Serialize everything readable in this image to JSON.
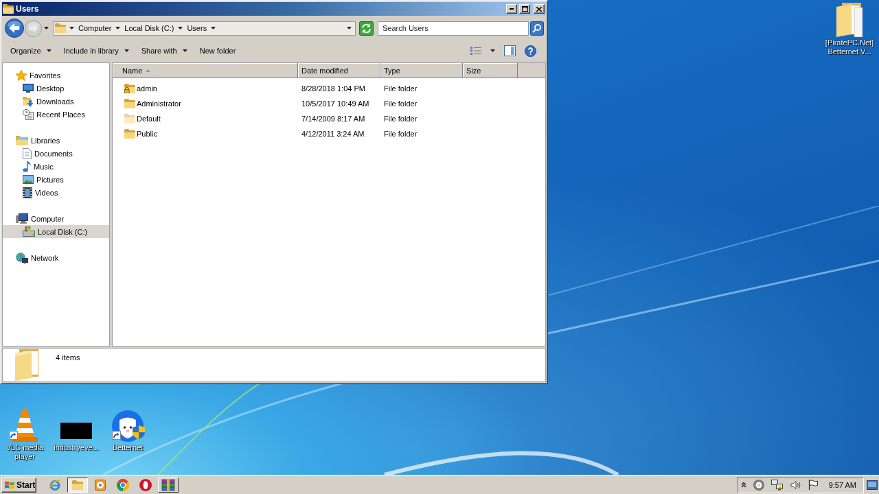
{
  "window": {
    "title": "Users"
  },
  "nav_buttons": [
    {
      "kind": "back",
      "disabled": false
    },
    {
      "kind": "forward",
      "disabled": true
    }
  ],
  "address_bar": {
    "crumbs": [
      "Computer",
      "Local Disk (C:)",
      "Users"
    ]
  },
  "search": {
    "placeholder": "Search Users"
  },
  "toolbar": {
    "buttons": [
      {
        "label": "Organize",
        "kind": "menu"
      },
      {
        "label": "Include in library",
        "kind": "menu"
      },
      {
        "label": "Share with",
        "kind": "menu"
      },
      {
        "label": "New folder",
        "kind": "plain"
      }
    ]
  },
  "navigation": {
    "groups": [
      {
        "label": "Favorites",
        "selected": false,
        "children": [
          {
            "label": "Desktop",
            "selected": false
          },
          {
            "label": "Downloads",
            "selected": false
          },
          {
            "label": "Recent Places",
            "selected": false
          }
        ]
      },
      {
        "label": "Libraries",
        "selected": false,
        "children": [
          {
            "label": "Documents",
            "selected": false
          },
          {
            "label": "Music",
            "selected": false
          },
          {
            "label": "Pictures",
            "selected": false
          },
          {
            "label": "Videos",
            "selected": false
          }
        ]
      },
      {
        "label": "Computer",
        "selected": false,
        "children": [
          {
            "label": "Local Disk (C:)",
            "selected": true
          }
        ]
      },
      {
        "label": "Network",
        "selected": false
      }
    ]
  },
  "file_list": {
    "columns": [
      {
        "label": "Name",
        "sorted": true
      },
      {
        "label": "Date modified",
        "sorted": false
      },
      {
        "label": "Type",
        "sorted": false
      },
      {
        "label": "Size",
        "sorted": false
      }
    ],
    "rows": [
      {
        "name": "admin",
        "date_modified": "8/28/2018 1:04 PM",
        "type": "File folder",
        "locked": true,
        "hidden": false
      },
      {
        "name": "Administrator",
        "date_modified": "10/5/2017 10:49 AM",
        "type": "File folder",
        "locked": false,
        "hidden": false
      },
      {
        "name": "Default",
        "date_modified": "7/14/2009 8:17 AM",
        "type": "File folder",
        "locked": false,
        "hidden": true
      },
      {
        "name": "Public",
        "date_modified": "4/12/2011 3:24 AM",
        "type": "File folder",
        "locked": false,
        "hidden": false
      }
    ]
  },
  "details_pane": {
    "summary": "4 items"
  },
  "desktop_items": [
    {
      "label": "[PiratePC.Net] Betternet V...",
      "shortcut": false,
      "elevated": false
    },
    {
      "label": "VLC media player",
      "shortcut": true,
      "elevated": false
    },
    {
      "label": "industryeve...",
      "shortcut": false,
      "elevated": false
    },
    {
      "label": "Betternet",
      "shortcut": true,
      "elevated": true
    }
  ],
  "taskbar": {
    "start_label": "Start",
    "apps": [
      {
        "selected": false,
        "running": false
      },
      {
        "selected": true,
        "running": true
      },
      {
        "selected": false,
        "running": false
      },
      {
        "selected": false,
        "running": false
      },
      {
        "selected": false,
        "running": false
      },
      {
        "selected": false,
        "running": true
      }
    ],
    "clock": "9:57 AM"
  }
}
